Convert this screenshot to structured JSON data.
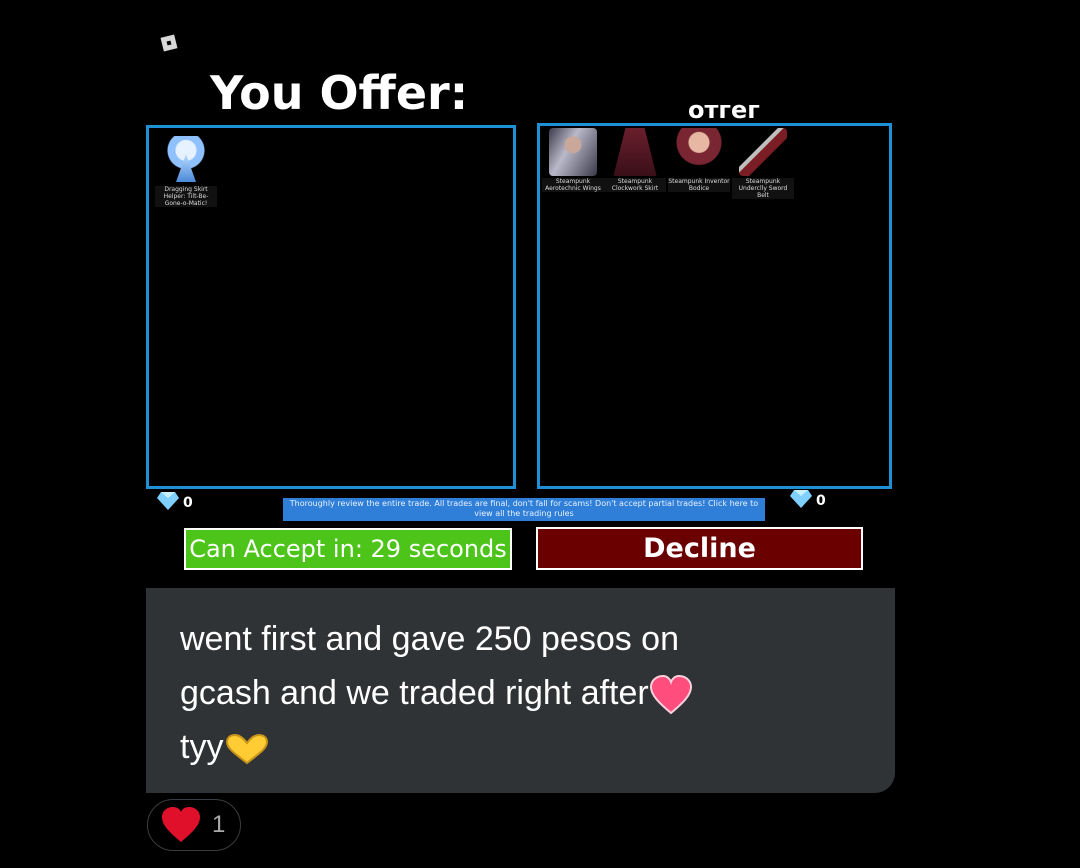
{
  "trade": {
    "you_offer_title": "You Offer:",
    "other_title": "отгег",
    "your_items": [
      {
        "label": "Dragging Skirt Helper: Tilt-Be-Gone-o-Matic!",
        "icon": "angel-skirt-icon"
      }
    ],
    "their_items": [
      {
        "label": "Steampunk Aerotechnic Wings",
        "icon": "steampunk-wings-icon"
      },
      {
        "label": "Steampunk Clockwork Skirt",
        "icon": "steampunk-skirt-icon"
      },
      {
        "label": "Steampunk Inventor Bodice",
        "icon": "steampunk-bodice-icon"
      },
      {
        "label": "Steampunk Underclly Sword Belt",
        "icon": "sword-belt-icon"
      }
    ],
    "your_diamonds": "0",
    "their_diamonds": "0",
    "notice": "Thoroughly review the entire trade. All trades are final, don't fall for scams! Don't accept partial trades! Click here to view all the trading rules",
    "accept_label": "Can Accept in: 29 seconds",
    "decline_label": "Decline"
  },
  "tweet": {
    "line1": "went first and gave 250 pesos on",
    "line2": "gcash and we traded right after",
    "line3": "tyy",
    "like_count": "1"
  },
  "colors": {
    "panel_border": "#1f8fd6",
    "accept_bg": "#4cc41a",
    "decline_bg": "#6b0000",
    "notice_bg": "#2f7ed8",
    "bubble_bg": "#2f3336"
  }
}
